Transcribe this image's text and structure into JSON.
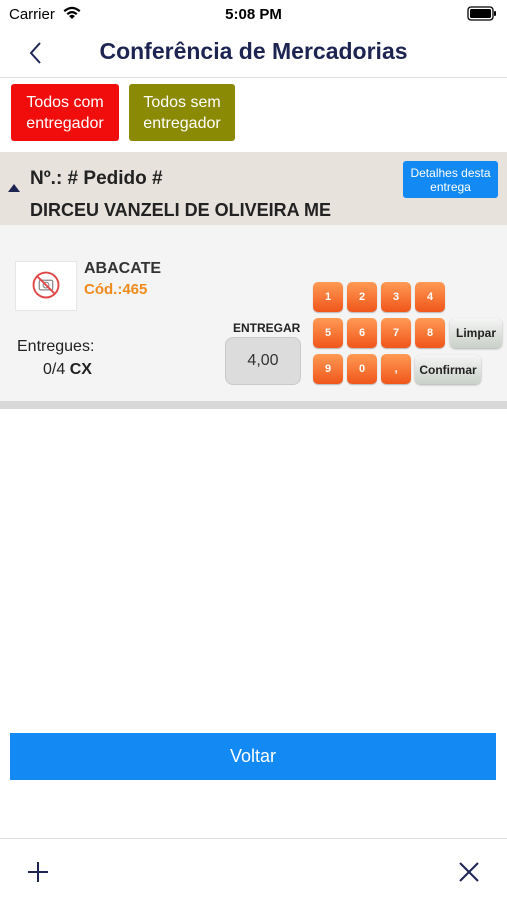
{
  "status_bar": {
    "carrier": "Carrier",
    "time": "5:08 PM"
  },
  "nav": {
    "title": "Conferência de Mercadorias"
  },
  "filters": {
    "with_driver_label": "Todos com entregador",
    "without_driver_label": "Todos sem entregador",
    "colors": {
      "with_driver": "#f20d0d",
      "without_driver": "#8b8a05"
    }
  },
  "order": {
    "number_label": "Nº.: # Pedido #",
    "customer": "DIRCEU VANZELI DE OLIVEIRA ME",
    "details_button": "Detalhes desta entrega"
  },
  "item": {
    "name": "ABACATE",
    "code_prefix": "Cód.:",
    "code": "465",
    "delivered_label": "Entregues:",
    "delivered_count": "0/4",
    "delivered_unit": "CX",
    "deliver_label": "ENTREGAR",
    "deliver_value": "4,00"
  },
  "keypad": {
    "row1": [
      "1",
      "2",
      "3",
      "4"
    ],
    "row2": [
      "5",
      "6",
      "7",
      "8"
    ],
    "row3": [
      "9",
      "0",
      ","
    ],
    "clear_label": "Limpar",
    "confirm_label": "Confirmar"
  },
  "footer": {
    "back_label": "Voltar"
  },
  "icons": {
    "status": [
      "wifi-icon",
      "battery-icon"
    ],
    "nav": "chevron-left-icon",
    "header": "triangle-up-icon",
    "thumbnail": "no-photo-icon",
    "toolbar": [
      "plus-icon",
      "close-icon"
    ]
  },
  "colors": {
    "accent": "#1289f3",
    "title": "#1d2452",
    "code": "#f08a1c",
    "keypad": "#f26a2a"
  }
}
